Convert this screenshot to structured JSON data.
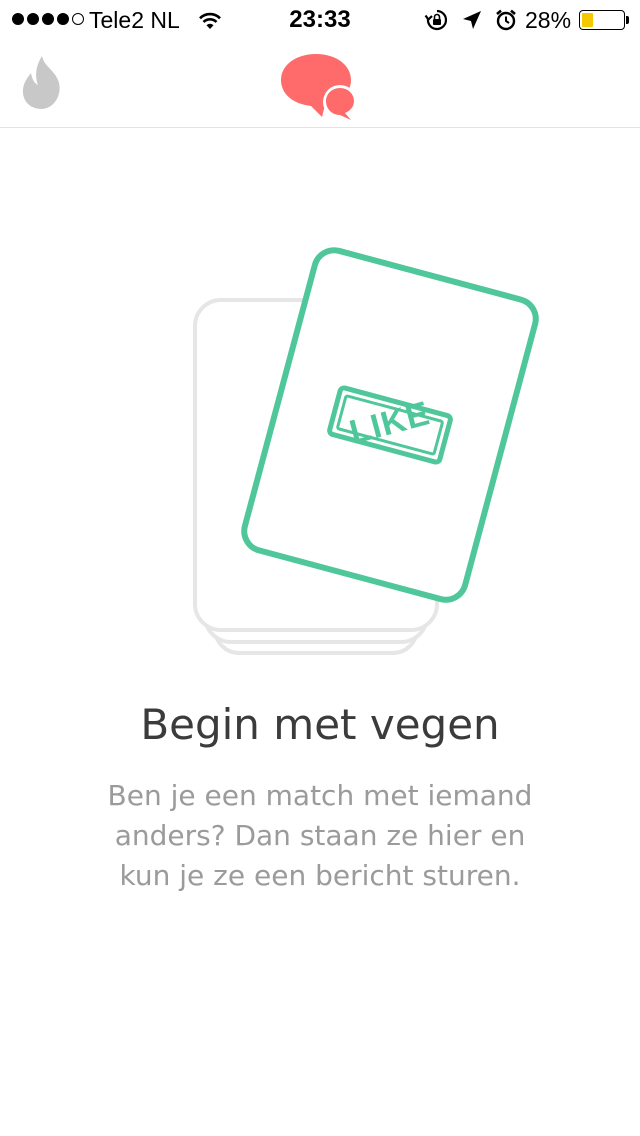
{
  "status_bar": {
    "carrier": "Tele2 NL",
    "time": "23:33",
    "battery_percent": "28%",
    "battery_level": 0.28,
    "icons": [
      "signal-dots",
      "wifi-icon",
      "rotation-lock-icon",
      "location-arrow-icon",
      "alarm-icon",
      "battery-icon"
    ]
  },
  "nav": {
    "left_icon": "flame-icon",
    "center_icon": "chat-bubbles-icon",
    "colors": {
      "inactive": "#c8c8c8",
      "active": "#ff6b6b"
    }
  },
  "illustration": {
    "stamp_text": "LIKE",
    "card_color": "#4fc79a",
    "stack_color": "#e6e6e6"
  },
  "empty_state": {
    "title": "Begin met vegen",
    "lines": [
      "Ben je een match met iemand",
      "anders? Dan staan ze hier en",
      "kun je ze een bericht sturen."
    ]
  }
}
